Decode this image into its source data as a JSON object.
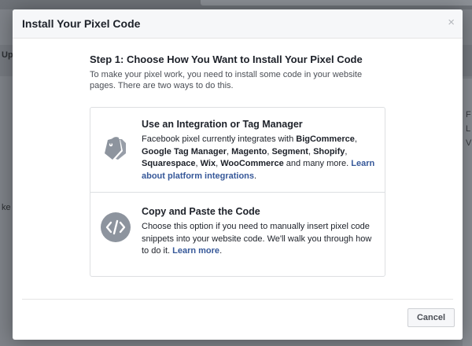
{
  "background": {
    "left_label_1": "Up",
    "left_label_2": "ke",
    "right_glyph_1": "F",
    "right_glyph_2": "L",
    "right_glyph_3": "V"
  },
  "modal": {
    "title": "Install Your Pixel Code",
    "close_glyph": "×",
    "step_title": "Step 1: Choose How You Want to Install Your Pixel Code",
    "step_description": "To make your pixel work, you need to install some code in your website pages. There are two ways to do this.",
    "options": [
      {
        "icon": "tags-icon",
        "title": "Use an Integration or Tag Manager",
        "text_1": "Facebook pixel currently integrates with ",
        "platforms": [
          "BigCommerce",
          "Google Tag Manager",
          "Magento",
          "Segment",
          "Shopify",
          "Squarespace",
          "Wix",
          "WooCommerce"
        ],
        "sep_comma": ", ",
        "text_2": " and many more. ",
        "link": "Learn about platform integrations",
        "text_end": "."
      },
      {
        "icon": "code-icon",
        "title": "Copy and Paste the Code",
        "text_1": "Choose this option if you need to manually insert pixel code snippets into your website code. We'll walk you through how to do it. ",
        "link": "Learn more",
        "text_end": "."
      }
    ],
    "cancel_label": "Cancel"
  },
  "colors": {
    "link": "#365899",
    "icon": "#8d949e",
    "header_bg": "#f6f7f9"
  }
}
